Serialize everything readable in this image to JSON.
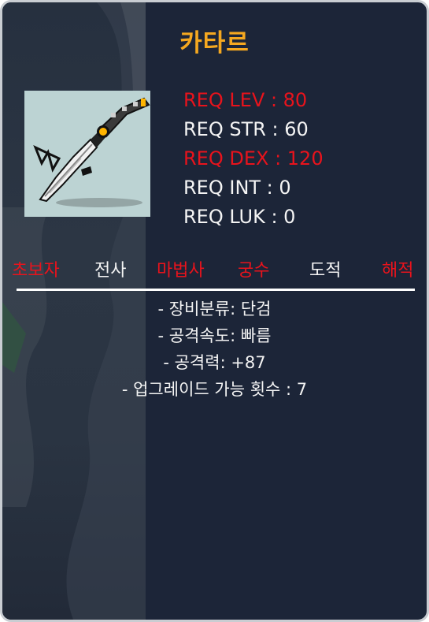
{
  "item": {
    "name": "카타르",
    "icon": "katar-weapon-icon"
  },
  "requirements": [
    {
      "label": "REQ LEV : 80",
      "status": "unmet"
    },
    {
      "label": "REQ STR : 60",
      "status": "met"
    },
    {
      "label": "REQ DEX : 120",
      "status": "unmet"
    },
    {
      "label": "REQ INT : 0",
      "status": "met"
    },
    {
      "label": "REQ LUK : 0",
      "status": "met"
    }
  ],
  "jobs": [
    {
      "label": "초보자",
      "status": "unavailable"
    },
    {
      "label": "전사",
      "status": "available"
    },
    {
      "label": "마법사",
      "status": "unavailable"
    },
    {
      "label": "궁수",
      "status": "unavailable"
    },
    {
      "label": "도적",
      "status": "available"
    },
    {
      "label": "해적",
      "status": "unavailable"
    }
  ],
  "stats": [
    "- 장비분류: 단검",
    "- 공격속도: 빠름",
    "- 공격력: +87",
    "- 업그레이드 가능 횟수 : 7"
  ],
  "colors": {
    "title": "#f5a820",
    "met": "#f4f4f4",
    "unmet": "#e8131c",
    "panel": "#1c2538"
  }
}
